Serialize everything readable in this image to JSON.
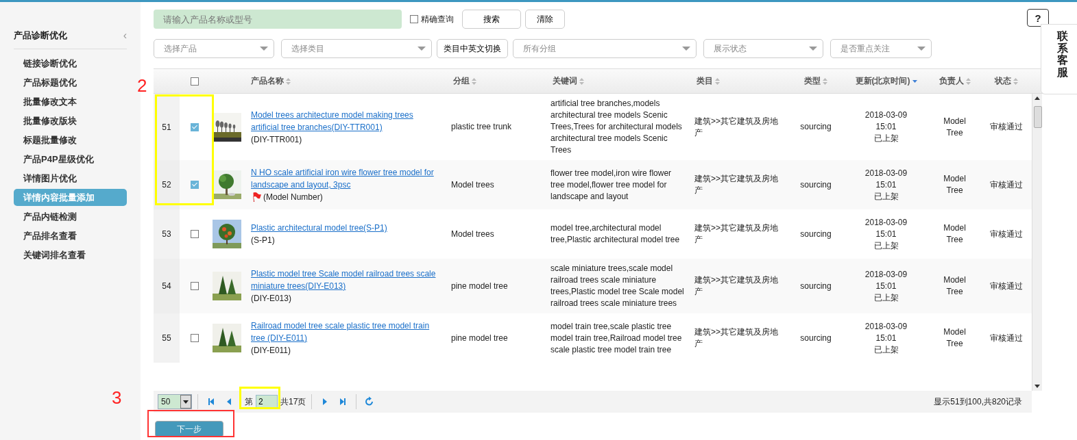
{
  "sidebar": {
    "title": "产品诊断优化",
    "collapse_icon": "‹",
    "items": [
      {
        "label": "链接诊断优化",
        "selected": false
      },
      {
        "label": "产品标题优化",
        "selected": false
      },
      {
        "label": "批量修改文本",
        "selected": false
      },
      {
        "label": "批量修改版块",
        "selected": false
      },
      {
        "label": "标题批量修改",
        "selected": false
      },
      {
        "label": "产品P4P星级优化",
        "selected": false
      },
      {
        "label": "详情图片优化",
        "selected": false
      },
      {
        "label": "详情内容批量添加",
        "selected": true
      },
      {
        "label": "产品内链检测",
        "selected": false
      },
      {
        "label": "产品排名查看",
        "selected": false
      },
      {
        "label": "关键词排名查看",
        "selected": false
      }
    ]
  },
  "search": {
    "placeholder": "请输入产品名称或型号",
    "exact_label": "精确查询",
    "exact_checked": false,
    "buttons": [
      "搜索",
      "清除"
    ]
  },
  "help": {
    "label": "?"
  },
  "contact": {
    "label": "联系客服"
  },
  "filters": [
    {
      "kind": "select",
      "placeholder": "选择产品"
    },
    {
      "kind": "select",
      "placeholder": "选择类目"
    },
    {
      "kind": "button",
      "label": "类目中英文切换"
    },
    {
      "kind": "select",
      "placeholder": "所有分组"
    },
    {
      "kind": "select",
      "placeholder": "展示状态"
    },
    {
      "kind": "select",
      "placeholder": "是否重点关注"
    }
  ],
  "table": {
    "select_all_checked": false,
    "columns": [
      {
        "label": "产品名称",
        "sorted": false
      },
      {
        "label": "分组",
        "sorted": false
      },
      {
        "label": "关键词",
        "sorted": false
      },
      {
        "label": "类目",
        "sorted": false
      },
      {
        "label": "类型",
        "sorted": false
      },
      {
        "label": "更新(北京时间)",
        "sorted": true
      },
      {
        "label": "负责人",
        "sorted": false
      },
      {
        "label": "状态",
        "sorted": false
      }
    ],
    "rows": [
      {
        "index": "51",
        "checked": true,
        "title": "Model trees architecture model making trees artificial tree branches(DIY-TTR001)",
        "model": "(DIY-TTR001)",
        "flagged": false,
        "group": "plastic tree trunk",
        "keywords": "artificial tree branches,models architectural tree models Scenic Trees,Trees for architectural models architectural tree models Scenic Trees",
        "category": "建筑>>其它建筑及房地产",
        "type": "sourcing",
        "date": "2018-03-09",
        "time": "15:01",
        "listing": "已上架",
        "owner": "Model Tree",
        "status": "审核通过"
      },
      {
        "index": "52",
        "checked": true,
        "title": "N HO scale artificial iron wire flower tree model for landscape and layout, 3psc",
        "model": "(Model Number)",
        "flagged": true,
        "group": "Model trees",
        "keywords": "flower tree model,iron wire flower tree model,flower tree model for landscape and layout",
        "category": "建筑>>其它建筑及房地产",
        "type": "sourcing",
        "date": "2018-03-09",
        "time": "15:01",
        "listing": "已上架",
        "owner": "Model Tree",
        "status": "审核通过"
      },
      {
        "index": "53",
        "checked": false,
        "title": "Plastic architectural model tree(S-P1)",
        "model": "(S-P1)",
        "flagged": false,
        "group": "Model trees",
        "keywords": "model tree,architectural model tree,Plastic architectural model tree",
        "category": "建筑>>其它建筑及房地产",
        "type": "sourcing",
        "date": "2018-03-09",
        "time": "15:01",
        "listing": "已上架",
        "owner": "Model Tree",
        "status": "审核通过"
      },
      {
        "index": "54",
        "checked": false,
        "title": "Plastic model tree Scale model railroad trees scale miniature trees(DIY-E013)",
        "model": "(DIY-E013)",
        "flagged": false,
        "group": "pine model tree",
        "keywords": "scale miniature trees,scale model railroad trees scale miniature trees,Plastic model tree Scale model railroad trees scale miniature trees",
        "category": "建筑>>其它建筑及房地产",
        "type": "sourcing",
        "date": "2018-03-09",
        "time": "15:01",
        "listing": "已上架",
        "owner": "Model Tree",
        "status": "审核通过"
      },
      {
        "index": "55",
        "checked": false,
        "title": "Railroad model tree scale plastic tree model train tree (DIY-E011)",
        "model": "(DIY-E011)",
        "flagged": false,
        "group": "pine model tree",
        "keywords": "model train tree,scale plastic tree model train tree,Railroad model tree scale plastic tree model train tree",
        "category": "建筑>>其它建筑及房地产",
        "type": "sourcing",
        "date": "2018-03-09",
        "time": "15:01",
        "listing": "已上架",
        "owner": "Model Tree",
        "status": "审核通过"
      }
    ]
  },
  "pager": {
    "page_size": "50",
    "page_prefix": "第",
    "page": "2",
    "page_total": "共17页",
    "summary": "显示51到100,共820记录"
  },
  "next_button": "下一步",
  "annotations": [
    {
      "kind": "number",
      "text": "2"
    },
    {
      "kind": "highlight"
    },
    {
      "kind": "number",
      "text": "3"
    },
    {
      "kind": "highlight"
    },
    {
      "kind": "frame"
    }
  ]
}
